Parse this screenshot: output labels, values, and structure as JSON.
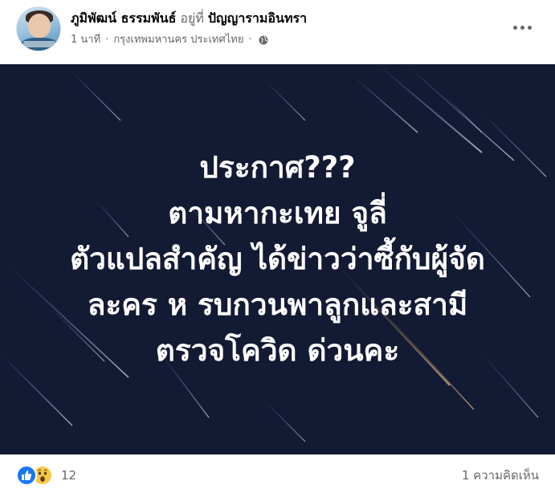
{
  "post": {
    "author": "ภูมิพัฒน์ ธรรมพันธ์",
    "at_text": "อยู่ที่",
    "place": "ปัญญารามอินทรา",
    "time": "1 นาที",
    "separator": "·",
    "location": "กรุงเทพมหานคร ประเทศไทย",
    "privacy_icon": "globe-icon",
    "more_icon": "more-options-icon"
  },
  "image": {
    "background_color": "#131a33",
    "text_color": "#ffffff",
    "lines": [
      "ประกาศ???",
      "ตามหากะเทย จูลี่",
      "ตัวแปลสำคัญ ได้ข่าวว่าซี้กับผู้จัด",
      "ละคร ห รบกวนพาลูกและสามี",
      "ตรวจโควิด ด่วนคะ"
    ]
  },
  "footer": {
    "reaction_icons": [
      "like-reaction-icon",
      "wow-reaction-icon"
    ],
    "reaction_count": "12",
    "comments_text": "1 ความคิดเห็น"
  },
  "colors": {
    "secondary_text": "#65676b",
    "primary_text": "#050505",
    "like_blue": "#1877f2",
    "wow_yellow": "#f7c747"
  }
}
